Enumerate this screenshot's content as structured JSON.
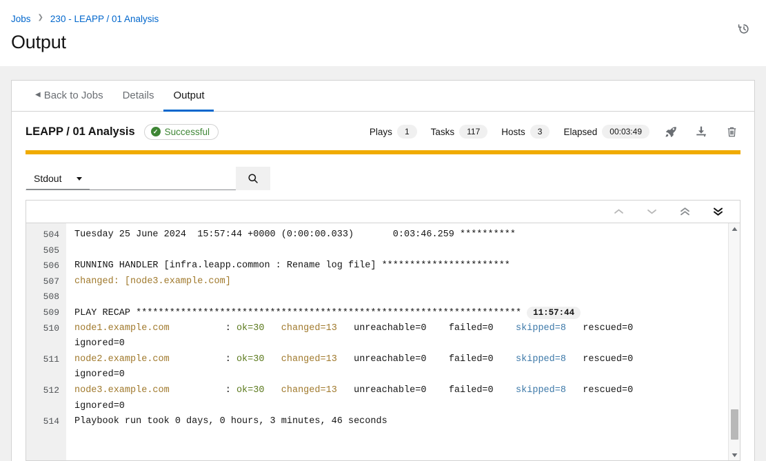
{
  "header": {
    "breadcrumb": [
      {
        "label": "Jobs"
      },
      {
        "label": "230 - LEAPP / 01 Analysis"
      }
    ],
    "title": "Output",
    "history_icon": "history-icon"
  },
  "tabs": [
    {
      "label": "Back to Jobs",
      "active": false
    },
    {
      "label": "Details",
      "active": false
    },
    {
      "label": "Output",
      "active": true
    }
  ],
  "job": {
    "name": "LEAPP / 01 Analysis",
    "status": "Successful",
    "status_color": "#3e8635",
    "progress_color": "#f0ab00",
    "stats": [
      {
        "label": "Plays",
        "value": "1"
      },
      {
        "label": "Tasks",
        "value": "117"
      },
      {
        "label": "Hosts",
        "value": "3"
      },
      {
        "label": "Elapsed",
        "value": "00:03:49"
      }
    ],
    "actions": [
      {
        "icon": "rocket-icon",
        "name": "relaunch-job-button"
      },
      {
        "icon": "download-icon",
        "name": "download-output-button"
      },
      {
        "icon": "trash-icon",
        "name": "delete-job-button"
      }
    ]
  },
  "search": {
    "filter_label": "Stdout",
    "value": "",
    "placeholder": "",
    "search_icon": "search-icon"
  },
  "console_nav": [
    {
      "name": "scroll-previous-button",
      "icon": "chevron-up-icon"
    },
    {
      "name": "scroll-next-button",
      "icon": "chevron-down-icon"
    },
    {
      "name": "scroll-first-button",
      "icon": "double-chevron-up-icon"
    },
    {
      "name": "scroll-last-button",
      "icon": "double-chevron-down-icon"
    }
  ],
  "console": {
    "lines": [
      {
        "num": "504",
        "segments": [
          {
            "text": "Tuesday 25 June 2024  15:57:44 +0000 (0:00:00.033)       0:03:46.259 **********",
            "color": "default"
          }
        ]
      },
      {
        "num": "505",
        "segments": [
          {
            "text": "",
            "color": "default"
          }
        ]
      },
      {
        "num": "506",
        "segments": [
          {
            "text": "RUNNING HANDLER [infra.leapp.common : Rename log file] ***********************",
            "color": "default"
          }
        ]
      },
      {
        "num": "507",
        "segments": [
          {
            "text": "changed: [node3.example.com]",
            "color": "amber"
          }
        ]
      },
      {
        "num": "508",
        "segments": [
          {
            "text": "",
            "color": "default"
          }
        ]
      },
      {
        "num": "509",
        "timestamp": "11:57:44",
        "segments": [
          {
            "text": "PLAY RECAP *********************************************************************",
            "color": "default"
          }
        ]
      },
      {
        "num": "510",
        "segments": [
          {
            "text": "node1.example.com",
            "color": "amber"
          },
          {
            "text": "          : ",
            "color": "default"
          },
          {
            "text": "ok=30",
            "color": "green"
          },
          {
            "text": "   ",
            "color": "default"
          },
          {
            "text": "changed=13",
            "color": "amber"
          },
          {
            "text": "   unreachable=0    failed=0    ",
            "color": "default"
          },
          {
            "text": "skipped=8",
            "color": "blue"
          },
          {
            "text": "   rescued=0",
            "color": "default"
          }
        ],
        "wrap": "ignored=0"
      },
      {
        "num": "511",
        "segments": [
          {
            "text": "node2.example.com",
            "color": "amber"
          },
          {
            "text": "          : ",
            "color": "default"
          },
          {
            "text": "ok=30",
            "color": "green"
          },
          {
            "text": "   ",
            "color": "default"
          },
          {
            "text": "changed=13",
            "color": "amber"
          },
          {
            "text": "   unreachable=0    failed=0    ",
            "color": "default"
          },
          {
            "text": "skipped=8",
            "color": "blue"
          },
          {
            "text": "   rescued=0",
            "color": "default"
          }
        ],
        "wrap": "ignored=0"
      },
      {
        "num": "512",
        "segments": [
          {
            "text": "node3.example.com",
            "color": "amber"
          },
          {
            "text": "          : ",
            "color": "default"
          },
          {
            "text": "ok=30",
            "color": "green"
          },
          {
            "text": "   ",
            "color": "default"
          },
          {
            "text": "changed=13",
            "color": "amber"
          },
          {
            "text": "   unreachable=0    failed=0    ",
            "color": "default"
          },
          {
            "text": "skipped=8",
            "color": "blue"
          },
          {
            "text": "   rescued=0",
            "color": "default"
          }
        ],
        "wrap": "ignored=0"
      },
      {
        "num": "514",
        "segments": [
          {
            "text": "Playbook run took 0 days, 0 hours, 3 minutes, 46 seconds",
            "color": "default"
          }
        ]
      }
    ]
  }
}
